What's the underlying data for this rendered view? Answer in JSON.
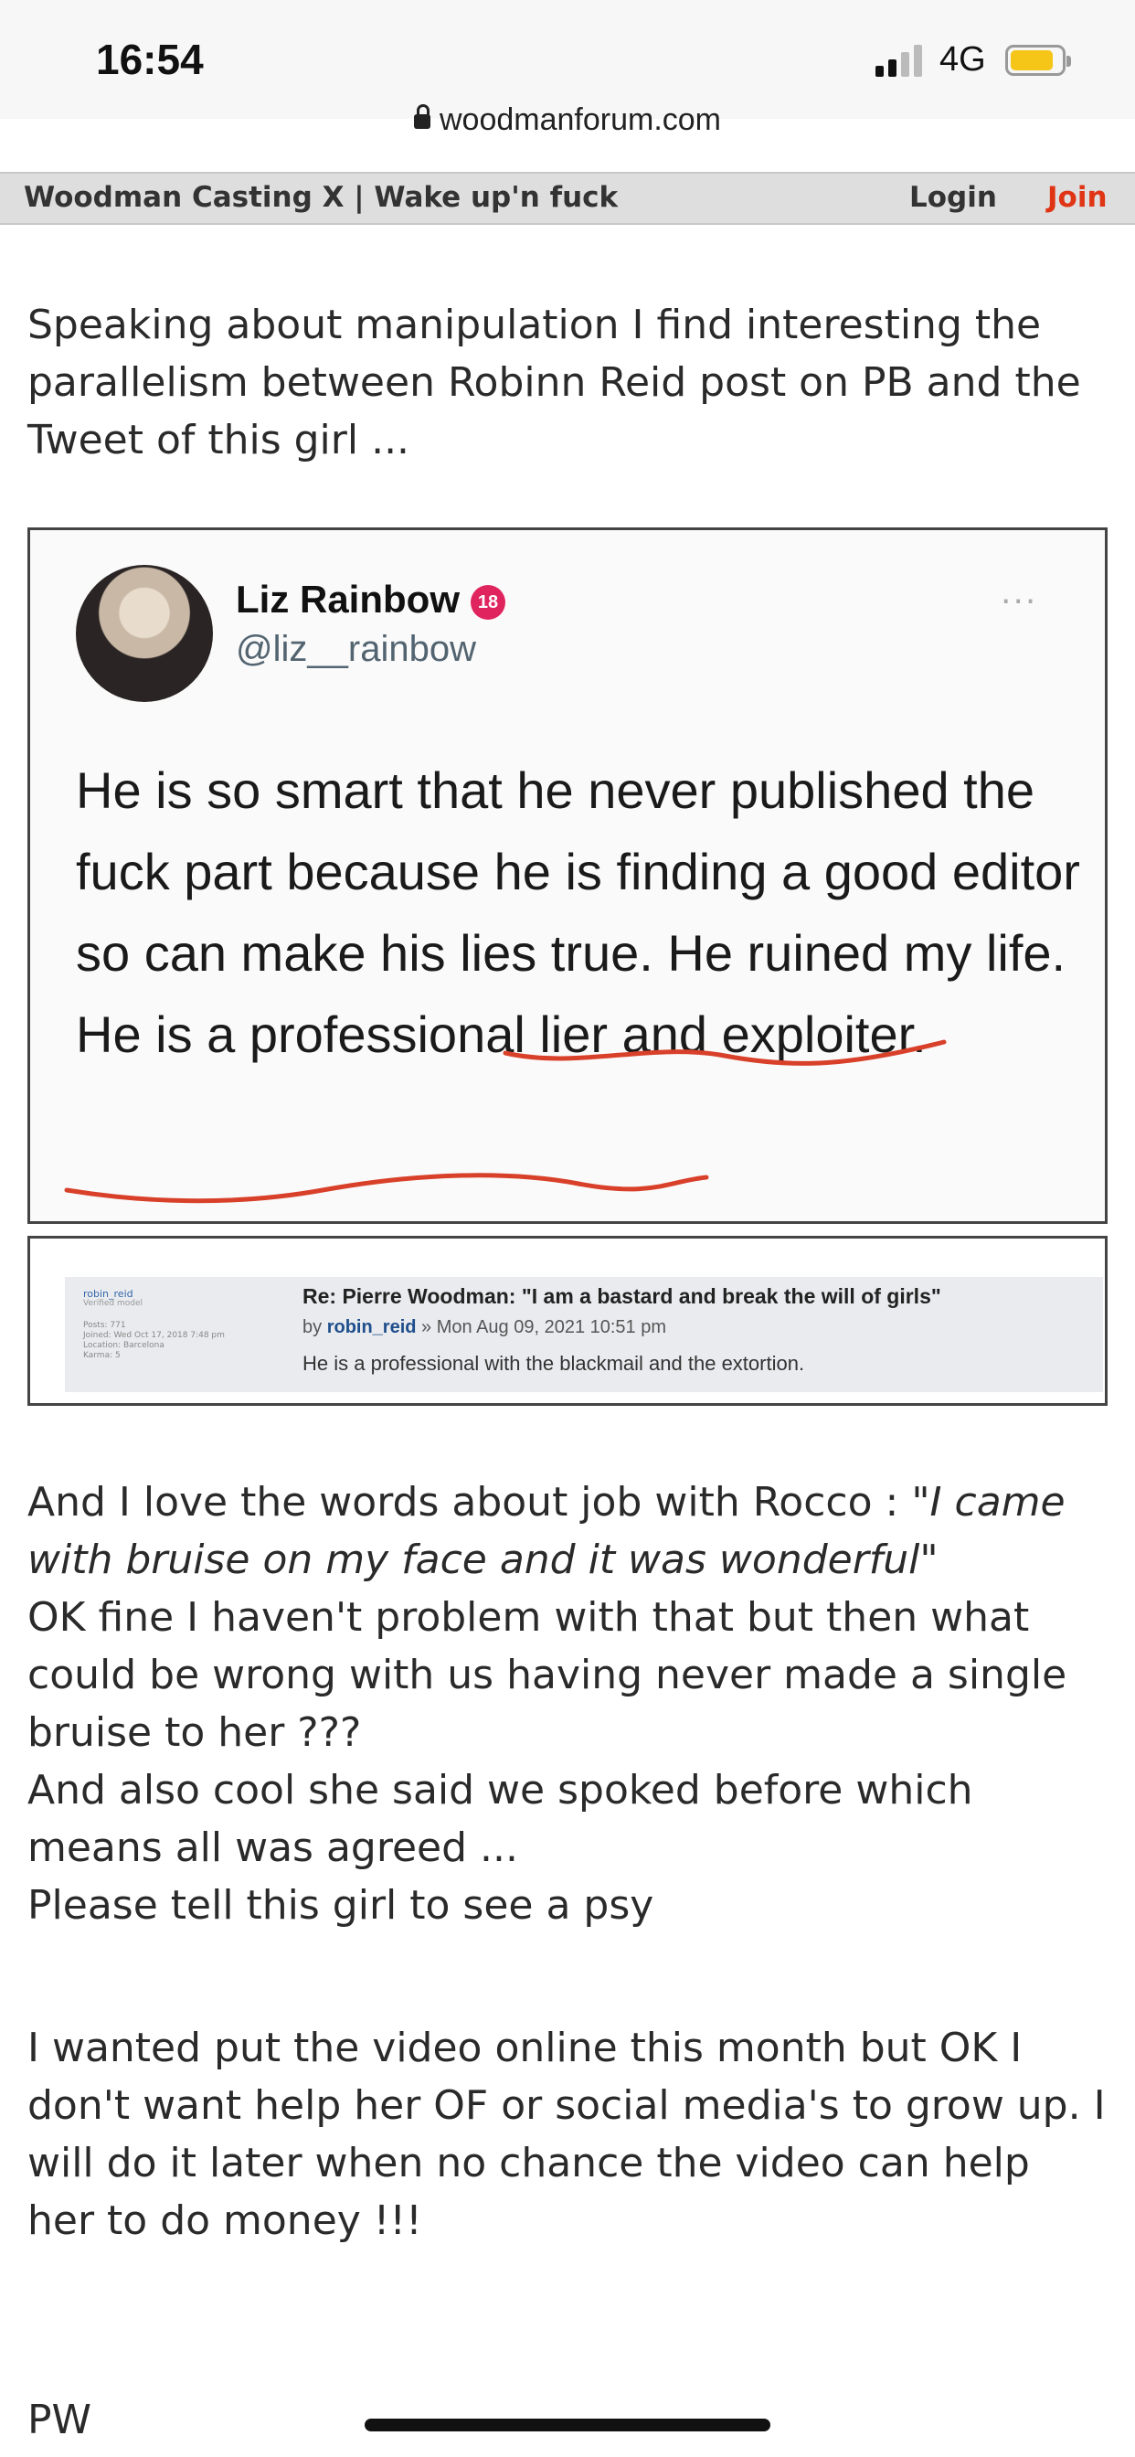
{
  "status_bar": {
    "time": "16:54",
    "network": "4G",
    "battery_color": "#f5c518"
  },
  "browser": {
    "url": "woodmanforum.com"
  },
  "forum_nav": {
    "title": "Woodman Casting X | Wake up'n fuck",
    "login": "Login",
    "join": "Join",
    "join_color": "#e03515"
  },
  "post": {
    "intro": "Speaking about manipulation I find interesting the parallelism between Robinn Reid post on PB and the Tweet of this girl ...",
    "tweet": {
      "name": "Liz Rainbow",
      "badge": "18",
      "handle": "@liz__rainbow",
      "more": "···",
      "text": "He is so smart that he never published the fuck part because he is finding a good editor so can make his lies true. He ruined my life. He is a professional lier and exploiter."
    },
    "forum_quote": {
      "user": "robin_reid",
      "rank": "Verified model",
      "meta": [
        "Posts: 771",
        "Joined: Wed Oct 17, 2018 7:48 pm",
        "Location: Barcelona",
        "Karma: 5"
      ],
      "title": "Re: Pierre Woodman: \"I am a bastard and break the will of girls\"",
      "by_prefix": "by",
      "by_user": "robin_reid",
      "by_date": " » Mon Aug 09, 2021 10:51 pm",
      "body": "He is a professional with the blackmail and the extortion."
    },
    "p2_before": "And I love the words about job with Rocco : ",
    "p2_quote": "\"I came with bruise on my face and it was wonderful\"",
    "p2_lines": [
      "OK fine I haven't problem with that but then what could be wrong with us having never made a single bruise to her ???",
      "And also cool she said we spoked before which means all was agreed ...",
      "Please tell this girl to see a psy"
    ],
    "p3": "I wanted put the video online this month but OK I don't want help her OF or social media's to grow up. I will do it later when no chance the video can help her to do money !!!",
    "signature": "PW"
  }
}
